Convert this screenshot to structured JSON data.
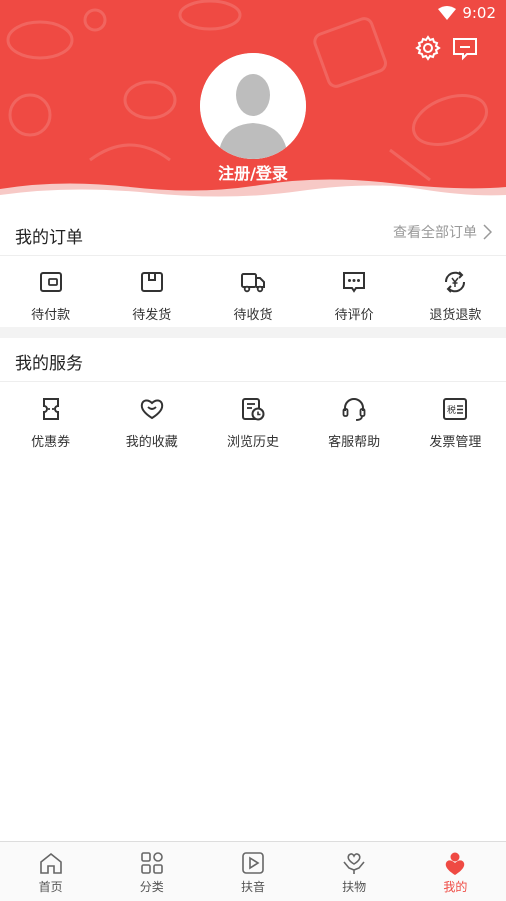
{
  "status": {
    "time": "9:02"
  },
  "header": {
    "login_label": "注册/登录"
  },
  "orders": {
    "title": "我的订单",
    "see_all": "查看全部订单",
    "items": [
      {
        "label": "待付款",
        "icon": "wallet-icon"
      },
      {
        "label": "待发货",
        "icon": "package-icon"
      },
      {
        "label": "待收货",
        "icon": "truck-icon"
      },
      {
        "label": "待评价",
        "icon": "comment-icon"
      },
      {
        "label": "退货退款",
        "icon": "refund-icon"
      }
    ]
  },
  "services": {
    "title": "我的服务",
    "items": [
      {
        "label": "优惠券",
        "icon": "coupon-icon"
      },
      {
        "label": "我的收藏",
        "icon": "heart-icon"
      },
      {
        "label": "浏览历史",
        "icon": "history-icon"
      },
      {
        "label": "客服帮助",
        "icon": "headset-icon"
      },
      {
        "label": "发票管理",
        "icon": "invoice-icon",
        "icon_text": "税"
      }
    ]
  },
  "tabbar": {
    "active": 4,
    "active_color": "#ef4a43",
    "items": [
      {
        "label": "首页",
        "icon": "home-icon"
      },
      {
        "label": "分类",
        "icon": "category-icon"
      },
      {
        "label": "扶音",
        "icon": "video-icon"
      },
      {
        "label": "扶物",
        "icon": "hands-icon"
      },
      {
        "label": "我的",
        "icon": "user-icon"
      }
    ]
  },
  "colors": {
    "brand": "#ef4a43",
    "gap": "#f3f3f3"
  }
}
